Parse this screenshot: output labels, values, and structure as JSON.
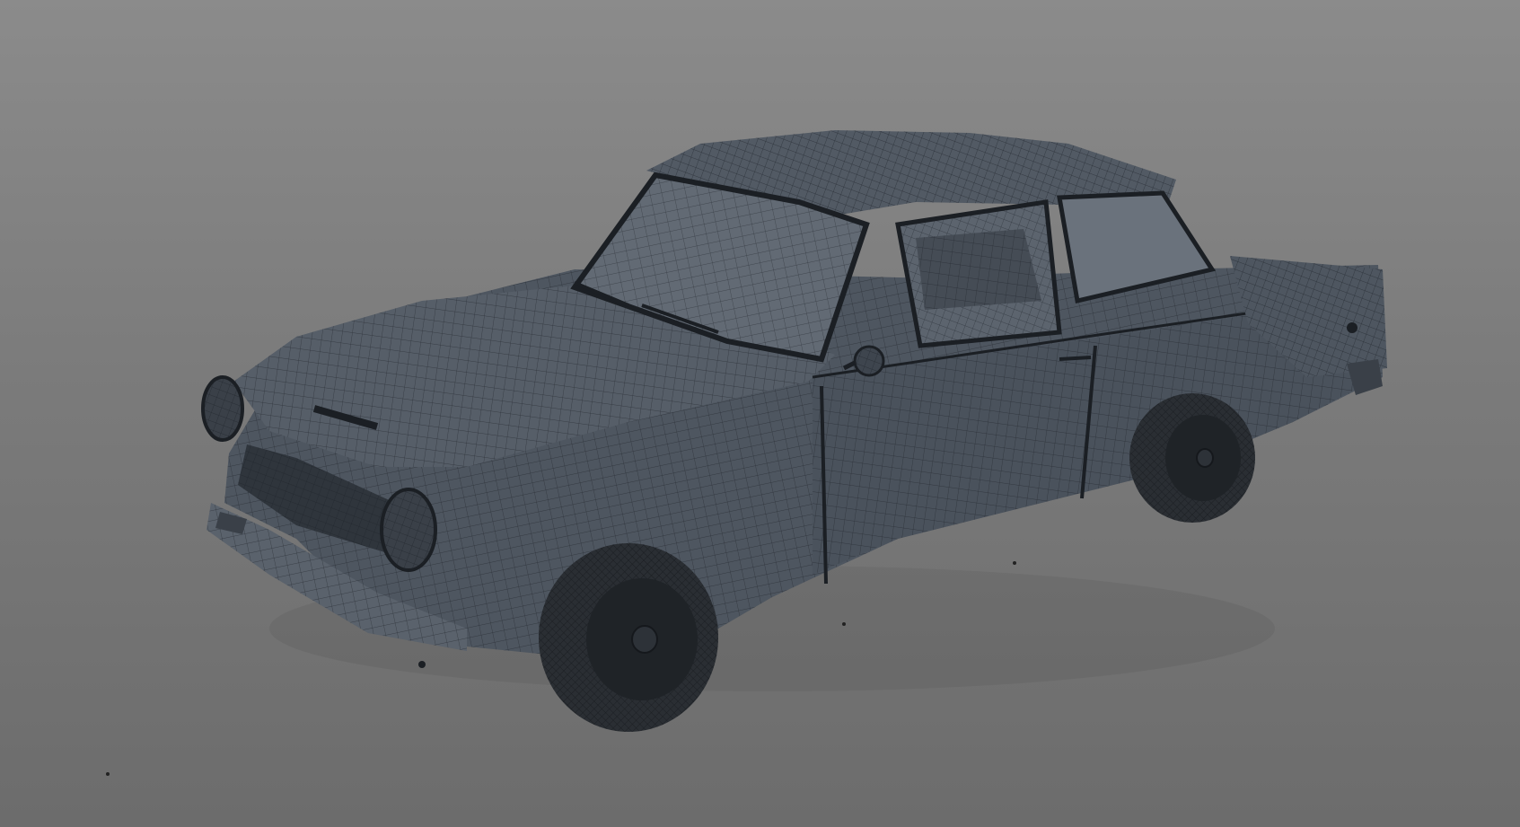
{
  "scene": {
    "subject": "car-wireframe-render",
    "background_top": "#8b8b8b",
    "background_bottom": "#6c6c6c",
    "body_color": "#4e5660",
    "body_shadow": "#3c424a",
    "glass_color": "#626a74",
    "wire_color": "#1e2329",
    "tire_color": "#2a2e33",
    "hub_color": "#1f2327"
  }
}
